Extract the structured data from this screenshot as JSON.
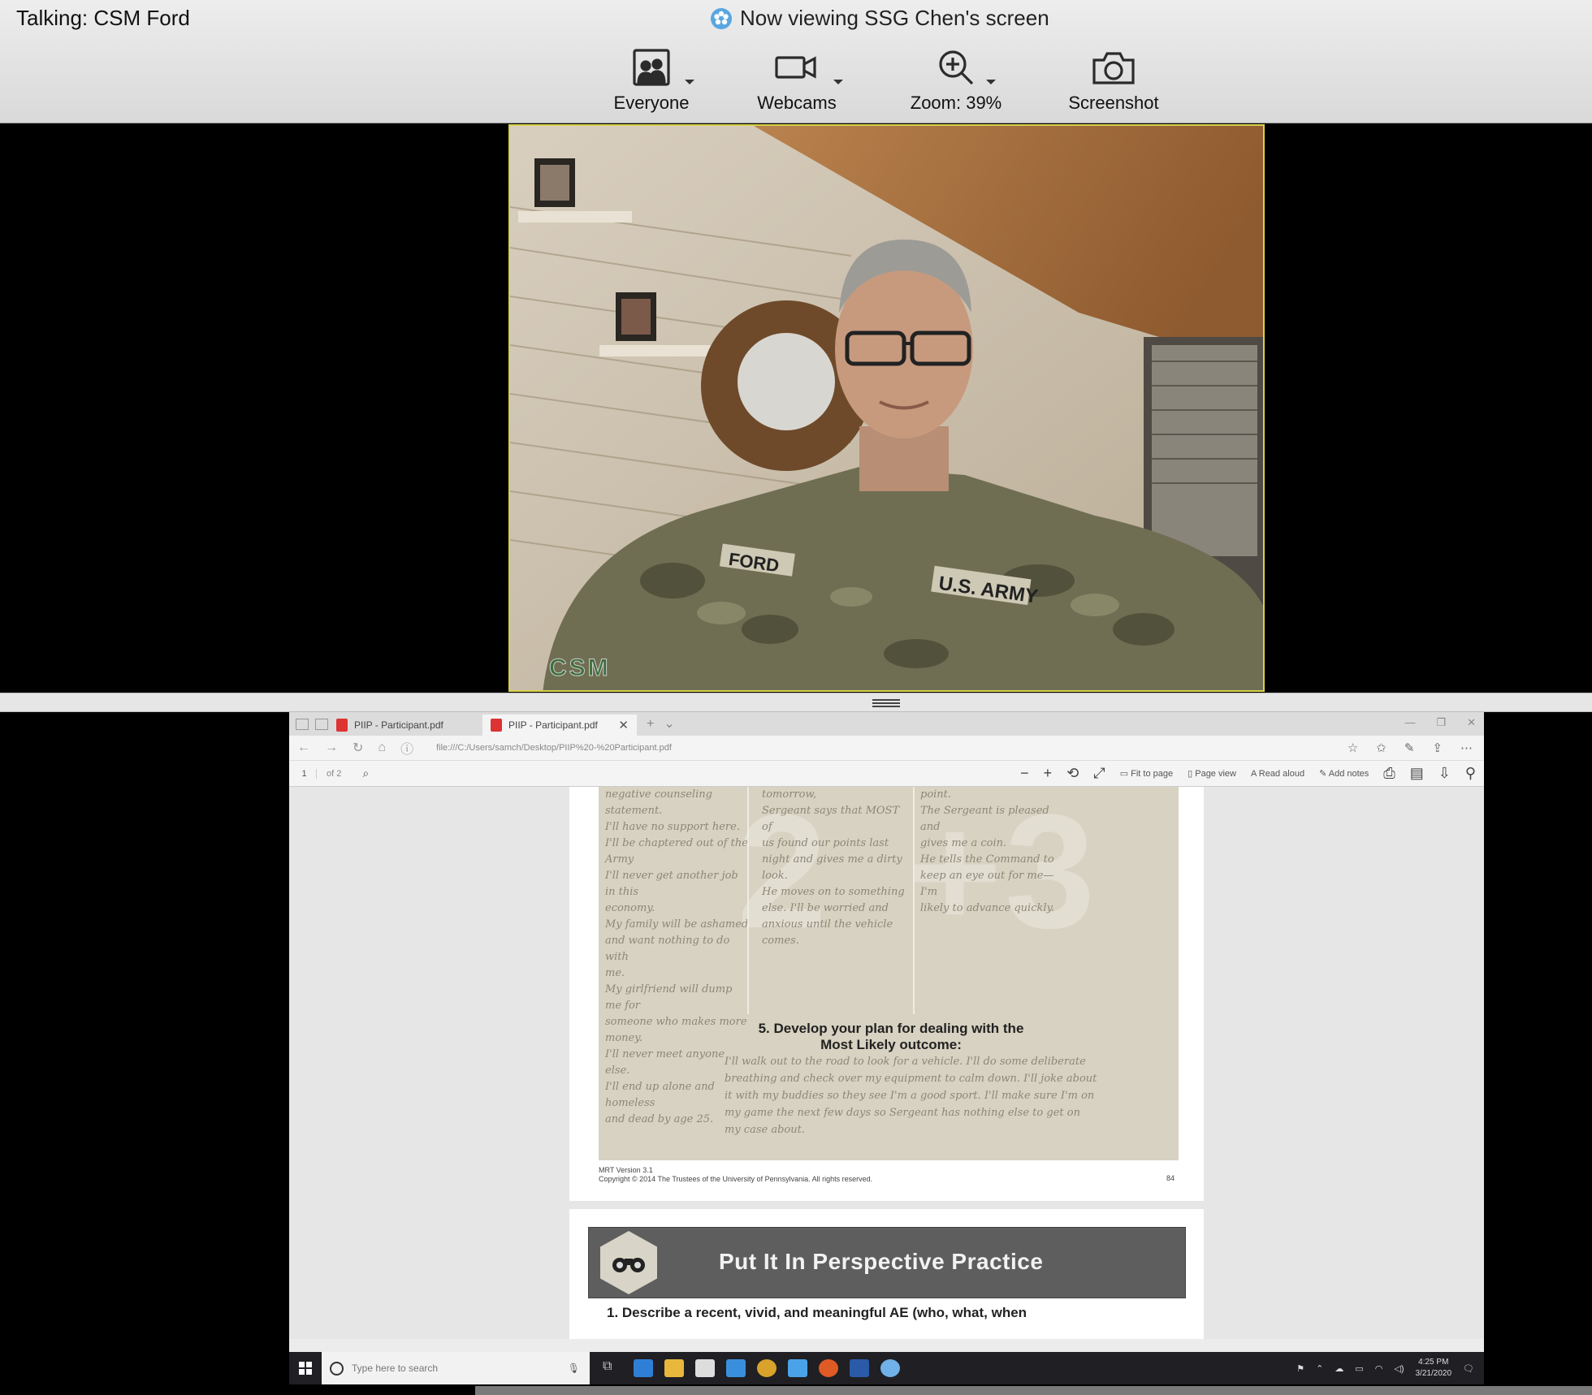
{
  "header": {
    "talking": "Talking: CSM Ford",
    "viewing": "Now viewing SSG Chen's screen"
  },
  "toolbar": {
    "everyone": "Everyone",
    "webcams": "Webcams",
    "zoom": "Zoom: 39%",
    "screenshot": "Screenshot"
  },
  "webcam": {
    "tag": "CSM"
  },
  "browser": {
    "tabs": [
      {
        "label": "PIIP - Participant.pdf"
      },
      {
        "label": "PIIP - Participant.pdf"
      }
    ],
    "url": "file:///C:/Users/samch/Desktop/PIIP%20-%20Participant.pdf",
    "page_current": "1",
    "page_total": "of 2",
    "tools": {
      "fit": "Fit to page",
      "page_view": "Page view",
      "read_aloud": "Read aloud",
      "add_notes": "Add notes"
    }
  },
  "pdf": {
    "col1": "against me AND I'll get a\nnegative counseling statement.\nI'll have no support here.\nI'll be chaptered out of the Army\nI'll never get another job in this\neconomy.\nMy family will be ashamed\nand want nothing to do with\nme.\nMy girlfriend will dump me for\nsomeone who makes more\nmoney.\nI'll never meet anyone else.\nI'll end up alone and homeless\nand dead by age 25.",
    "col2": "At first formation tomorrow,\nSergeant says that MOST of\nus found our points last\nnight and gives me a dirty\nlook.\nHe moves on to something\nelse. I'll be worried and\nanxious until the vehicle\ncomes.",
    "col3": "them back to the check-in\npoint.\nThe Sergeant is pleased and\ngives me a coin.\nHe tells the Command to\nkeep an eye out for me—I'm\nlikely to advance quickly.",
    "plan_title": "5. Develop your plan for dealing with the Most Likely outcome:",
    "plan_body": "I'll walk out to the road to look for a vehicle. I'll do some deliberate breathing and check over my equipment to calm down. I'll joke about it with my buddies so they see I'm a good sport. I'll make sure I'm on my game the next few days so Sergeant has nothing else to get on my case about.",
    "footer_version": "MRT Version 3.1",
    "footer_copyright": "Copyright © 2014 The Trustees of the University of Pennsylvania.  All rights reserved.",
    "page_number": "84",
    "banner_title": "Put It In Perspective Practice",
    "question1": "1. Describe a recent, vivid, and meaningful AE (who, what, when"
  },
  "taskbar": {
    "search_placeholder": "Type here to search",
    "time": "4:25 PM",
    "date": "3/21/2020"
  }
}
